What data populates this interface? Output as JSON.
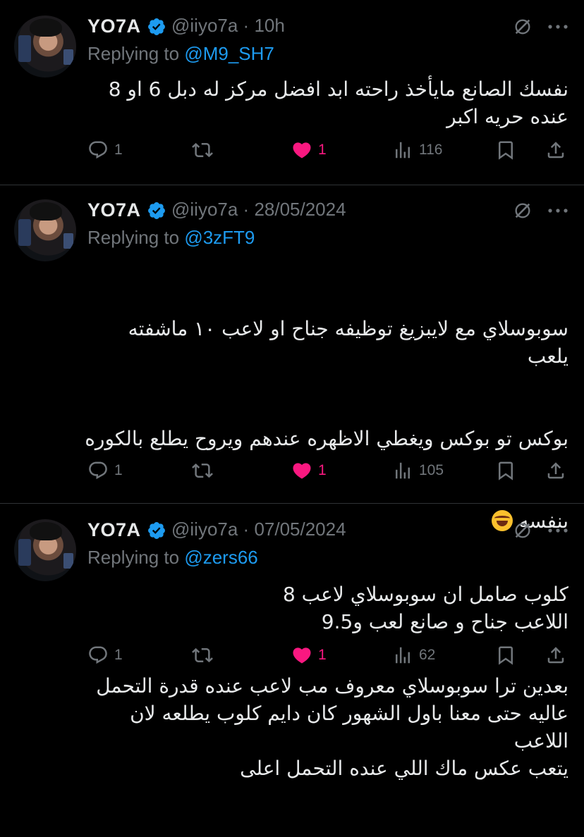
{
  "theme": {
    "accent": "#1d9bf0",
    "like": "#f91880",
    "muted": "#71767b",
    "text": "#e7e9ea"
  },
  "tweets": [
    {
      "name": "YO7A",
      "handle": "@iiyo7a",
      "time": "10h",
      "replying_prefix": "Replying to ",
      "mention": "@M9_SH7",
      "body": "نفسك الصانع مايأخذ راحته ابد افضل مركز له دبل 6 او 8\nعنده حريه اكبر",
      "replies": "1",
      "retweets": "",
      "likes": "1",
      "views": "116"
    },
    {
      "name": "YO7A",
      "handle": "@iiyo7a",
      "time": "28/05/2024",
      "replying_prefix": "Replying to ",
      "mention": "@3zFT9",
      "body_line1": "سوبوسلاي مع لايبزيغ توظيفه جناح او لاعب ١٠ ماشفته يلعب",
      "body_line2": "بوكس تو بوكس ويغطي الاظهره عندهم ويروح يطلع بالكوره",
      "body_line3": "بنفسه",
      "emoji": "face-with-tears-of-joy",
      "body_para2": "بعدين ترا سوبوسلاي معروف مب لاعب عنده قدرة التحمل\nعاليه حتى معنا باول الشهور كان دايم كلوب يطلعه لان اللاعب\nيتعب عكس ماك اللي عنده التحمل اعلى",
      "replies": "1",
      "retweets": "",
      "likes": "1",
      "views": "105"
    },
    {
      "name": "YO7A",
      "handle": "@iiyo7a",
      "time": "07/05/2024",
      "replying_prefix": "Replying to ",
      "mention": "@zers66",
      "body": "كلوب صامل ان سوبوسلاي لاعب 8\nاللاعب جناح و صانع لعب و9.5",
      "replies": "1",
      "retweets": "",
      "likes": "1",
      "views": "62"
    }
  ],
  "separator": " · ",
  "icons": {
    "verified": "verified-badge-icon",
    "grok": "grok-icon",
    "more": "more-icon",
    "reply": "reply-icon",
    "retweet": "retweet-icon",
    "like": "heart-icon",
    "views": "views-icon",
    "bookmark": "bookmark-icon",
    "share": "share-icon"
  }
}
